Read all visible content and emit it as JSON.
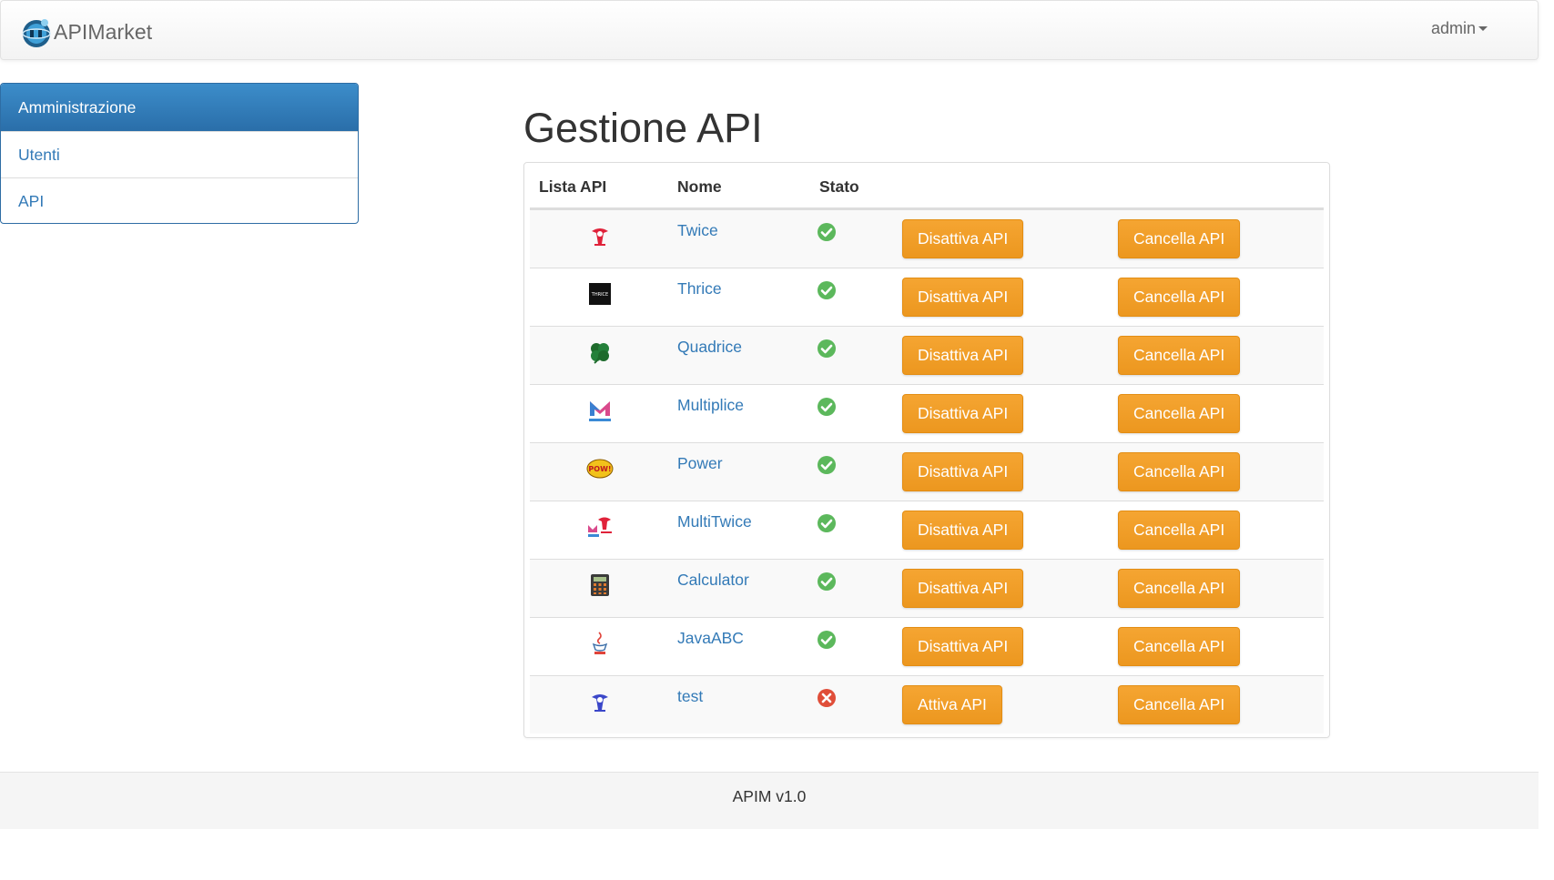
{
  "navbar": {
    "brand": "APIMarket",
    "user": "admin"
  },
  "sidebar": {
    "heading": "Amministrazione",
    "items": [
      {
        "label": "Utenti"
      },
      {
        "label": "API"
      }
    ]
  },
  "main": {
    "title": "Gestione API",
    "table": {
      "columns": [
        "Lista API",
        "Nome",
        "Stato"
      ],
      "rows": [
        {
          "icon": "twice-logo-icon",
          "name": "Twice",
          "status": "active",
          "toggle_label": "Disattiva API",
          "delete_label": "Cancella API"
        },
        {
          "icon": "thrice-logo-icon",
          "name": "Thrice",
          "status": "active",
          "toggle_label": "Disattiva API",
          "delete_label": "Cancella API",
          "icon_text": "THRICE"
        },
        {
          "icon": "clover-icon",
          "name": "Quadrice",
          "status": "active",
          "toggle_label": "Disattiva API",
          "delete_label": "Cancella API"
        },
        {
          "icon": "multiplex-logo-icon",
          "name": "Multiplice",
          "status": "active",
          "toggle_label": "Disattiva API",
          "delete_label": "Cancella API"
        },
        {
          "icon": "pow-icon",
          "name": "Power",
          "status": "active",
          "toggle_label": "Disattiva API",
          "delete_label": "Cancella API",
          "icon_text": "POW!"
        },
        {
          "icon": "multitwice-logo-icon",
          "name": "MultiTwice",
          "status": "active",
          "toggle_label": "Disattiva API",
          "delete_label": "Cancella API"
        },
        {
          "icon": "calculator-icon",
          "name": "Calculator",
          "status": "active",
          "toggle_label": "Disattiva API",
          "delete_label": "Cancella API"
        },
        {
          "icon": "java-abc-icon",
          "name": "JavaABC",
          "status": "active",
          "toggle_label": "Disattiva API",
          "delete_label": "Cancella API"
        },
        {
          "icon": "test-logo-icon",
          "name": "test",
          "status": "inactive",
          "toggle_label": "Attiva API",
          "delete_label": "Cancella API"
        }
      ]
    }
  },
  "footer": {
    "text": "APIM v1.0"
  },
  "colors": {
    "primary": "#337ab7",
    "warning": "#f0ad4e",
    "success": "#5cb85c",
    "danger": "#e04e39"
  }
}
